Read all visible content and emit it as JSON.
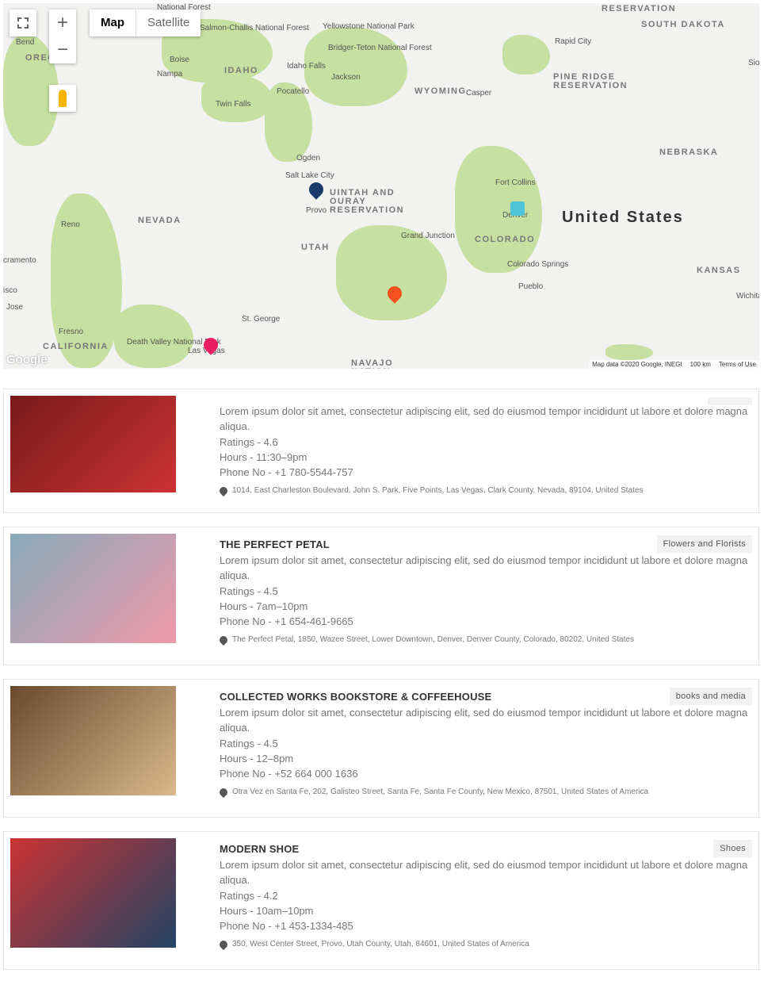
{
  "map": {
    "controls": {
      "fullscreen_icon": "fullscreen-icon",
      "zoom_in": "+",
      "zoom_out": "−",
      "map_label": "Map",
      "satellite_label": "Satellite",
      "pegman_icon": "pegman-icon"
    },
    "labels": [
      {
        "t": "National Forest",
        "c": "lbl"
      },
      {
        "t": "Salmon-Challis National Forest",
        "c": "lbl"
      },
      {
        "t": "Yellowstone National Park",
        "c": "lbl"
      },
      {
        "t": "Bridger-Teton National Forest",
        "c": "lbl"
      },
      {
        "t": "RESERVATION",
        "c": "lbl st"
      },
      {
        "t": "SOUTH DAKOTA",
        "c": "lbl st"
      },
      {
        "t": "Rapid City",
        "c": "lbl"
      },
      {
        "t": "Sio",
        "c": "lbl"
      },
      {
        "t": "Bend",
        "c": "lbl"
      },
      {
        "t": "OREG",
        "c": "lbl st"
      },
      {
        "t": "Boise",
        "c": "lbl"
      },
      {
        "t": "Nampa",
        "c": "lbl"
      },
      {
        "t": "IDAHO",
        "c": "lbl st"
      },
      {
        "t": "Idaho Falls",
        "c": "lbl"
      },
      {
        "t": "Jackson",
        "c": "lbl"
      },
      {
        "t": "WYOMING",
        "c": "lbl st"
      },
      {
        "t": "Casper",
        "c": "lbl"
      },
      {
        "t": "PINE RIDGE RESERVATION",
        "c": "lbl st"
      },
      {
        "t": "Pocatello",
        "c": "lbl"
      },
      {
        "t": "Twin Falls",
        "c": "lbl"
      },
      {
        "t": "NEBRASKA",
        "c": "lbl st"
      },
      {
        "t": "Ogden",
        "c": "lbl"
      },
      {
        "t": "Salt Lake City",
        "c": "lbl"
      },
      {
        "t": "Provo",
        "c": "lbl"
      },
      {
        "t": "UINTAH AND OURAY RESERVATION",
        "c": "lbl st"
      },
      {
        "t": "Fort Collins",
        "c": "lbl"
      },
      {
        "t": "Denver",
        "c": "lbl"
      },
      {
        "t": "United States",
        "c": "lbl big"
      },
      {
        "t": "NEVADA",
        "c": "lbl st"
      },
      {
        "t": "Reno",
        "c": "lbl"
      },
      {
        "t": "Grand Junction",
        "c": "lbl"
      },
      {
        "t": "COLORADO",
        "c": "lbl st"
      },
      {
        "t": "UTAH",
        "c": "lbl st"
      },
      {
        "t": "cramento",
        "c": "lbl"
      },
      {
        "t": "Colorado Springs",
        "c": "lbl"
      },
      {
        "t": "Pueblo",
        "c": "lbl"
      },
      {
        "t": "KANSAS",
        "c": "lbl st"
      },
      {
        "t": "isco",
        "c": "lbl"
      },
      {
        "t": "Jose",
        "c": "lbl"
      },
      {
        "t": "Wichita",
        "c": "lbl"
      },
      {
        "t": "St. George",
        "c": "lbl"
      },
      {
        "t": "Fresno",
        "c": "lbl"
      },
      {
        "t": "CALIFORNIA",
        "c": "lbl st"
      },
      {
        "t": "Death Valley National Park",
        "c": "lbl"
      },
      {
        "t": "Las Vegas",
        "c": "lbl"
      },
      {
        "t": "NAVAJO NATION",
        "c": "lbl st"
      }
    ],
    "google_logo": "Google",
    "attribution": "Map data ©2020 Google, INEGI",
    "scale": "100 km",
    "terms": "Terms of Use",
    "marker_colors": {
      "las_vegas": "#e91e63",
      "provo": "#1a3a6b",
      "denver": "#4fc3d7",
      "santa_fe": "#f4511e"
    }
  },
  "listings": [
    {
      "title": "",
      "category": "",
      "description": "Lorem ipsum dolor sit amet, consectetur adipiscing elit, sed do eiusmod tempor incididunt ut labore et dolore magna aliqua.",
      "ratings": "Ratings - 4.6",
      "hours": "Hours - 11:30–9pm",
      "phone": "Phone No - +1 780-5544-757",
      "address": "1014, East Charleston Boulevard, John S. Park, Five Points, Las Vegas, Clark County, Nevada, 89104, United States"
    },
    {
      "title": "THE PERFECT PETAL",
      "category": "Flowers and Florists",
      "description": "Lorem ipsum dolor sit amet, consectetur adipiscing elit, sed do eiusmod tempor incididunt ut labore et dolore magna aliqua.",
      "ratings": "Ratings - 4.5",
      "hours": "Hours - 7am–10pm",
      "phone": "Phone No - +1 654-461-9665",
      "address": "The Perfect Petal, 1850, Wazee Street, Lower Downtown, Denver, Denver County, Colorado, 80202, United States"
    },
    {
      "title": "COLLECTED WORKS BOOKSTORE & COFFEEHOUSE",
      "category": "books and media",
      "description": "Lorem ipsum dolor sit amet, consectetur adipiscing elit, sed do eiusmod tempor incididunt ut labore et dolore magna aliqua.",
      "ratings": "Ratings - 4.5",
      "hours": "Hours - 12–8pm",
      "phone": "Phone No - +52 664 000 1636",
      "address": "Otra Vez en Santa Fe, 202, Galisteo Street, Santa Fe, Santa Fe County, New Mexico, 87501, United States of America"
    },
    {
      "title": "MODERN SHOE",
      "category": "Shoes",
      "description": "Lorem ipsum dolor sit amet, consectetur adipiscing elit, sed do eiusmod tempor incididunt ut labore et dolore magna aliqua.",
      "ratings": "Ratings - 4.2",
      "hours": "Hours - 10am–10pm",
      "phone": "Phone No - +1 453-1334-485",
      "address": "350, West Center Street, Provo, Utah County, Utah, 84601, United States of America"
    }
  ]
}
